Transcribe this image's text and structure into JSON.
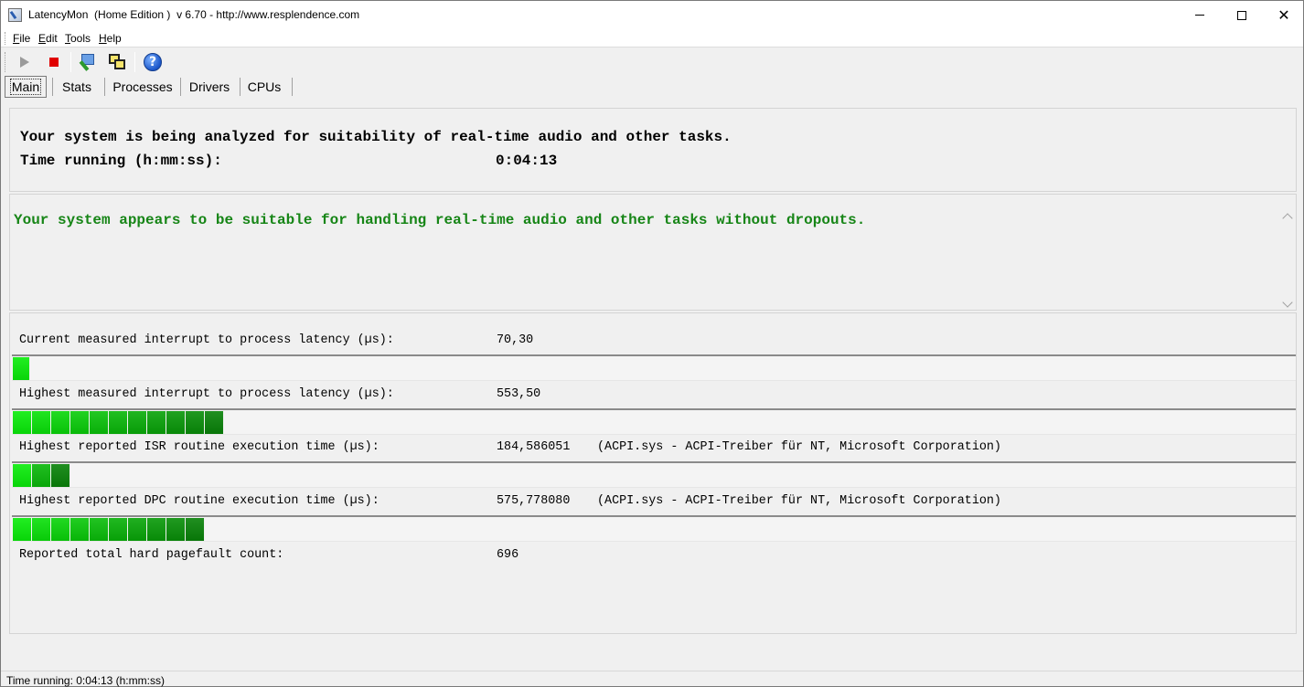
{
  "window": {
    "title": "LatencyMon  (Home Edition )  v 6.70 - http://www.resplendence.com"
  },
  "menu": [
    {
      "label": "File",
      "accel": "F",
      "rest": "ile"
    },
    {
      "label": "Edit",
      "accel": "E",
      "rest": "dit"
    },
    {
      "label": "Tools",
      "accel": "T",
      "rest": "ools"
    },
    {
      "label": "Help",
      "accel": "H",
      "rest": "elp"
    }
  ],
  "toolbar": {
    "icons": [
      "play-icon",
      "stop-icon",
      "inspect-icon",
      "windows-icon",
      "help-icon"
    ],
    "colors": {
      "stop": "#e00000",
      "play_disabled": "#9a9a9a"
    }
  },
  "tabs": [
    {
      "label": "Main",
      "active": true
    },
    {
      "label": "Stats",
      "active": false
    },
    {
      "label": "Processes",
      "active": false
    },
    {
      "label": "Drivers",
      "active": false
    },
    {
      "label": "CPUs",
      "active": false
    }
  ],
  "analysis": {
    "heading": "Your system is being analyzed for suitability of real-time audio and other tasks.",
    "time_label": "Time running (h:mm:ss):",
    "time_value": "0:04:13"
  },
  "verdict": {
    "text": "Your system appears to be suitable for handling real-time audio and other tasks without dropouts.",
    "color": "#168516"
  },
  "metrics": [
    {
      "label": "Current measured interrupt to process latency (µs):",
      "value": "70,30",
      "driver": "",
      "meter_segments": 1
    },
    {
      "label": "Highest measured interrupt to process latency (µs):",
      "value": "553,50",
      "driver": "",
      "meter_segments": 11
    },
    {
      "label": "Highest reported ISR routine execution time (µs):",
      "value": "184,586051",
      "driver": "(ACPI.sys - ACPI-Treiber für NT, Microsoft Corporation)",
      "meter_segments": 3
    },
    {
      "label": "Highest reported DPC routine execution time (µs):",
      "value": "575,778080",
      "driver": "(ACPI.sys - ACPI-Treiber für NT, Microsoft Corporation)",
      "meter_segments": 10
    },
    {
      "label": "Reported total hard pagefault count:",
      "value": "696",
      "driver": ""
    }
  ],
  "meter_colors": {
    "bright": "#22ee22",
    "dark": "#218f21"
  },
  "status": {
    "text": "Time running: 0:04:13  (h:mm:ss)"
  }
}
